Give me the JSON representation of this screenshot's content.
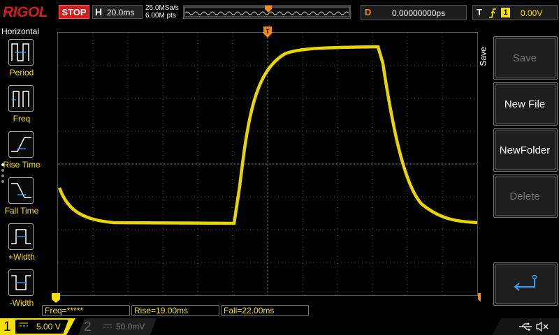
{
  "header": {
    "brand": "RIGOL",
    "run_state": "STOP",
    "timebase_letter": "H",
    "timebase": "20.0ms",
    "sample_rate": "25.0MSa/s",
    "memory_depth": "6.00M pts",
    "delay_letter": "D",
    "delay": "0.00000000ps",
    "trigger_letter": "T",
    "trigger_source": "1",
    "trigger_level": "0.00V"
  },
  "left_panel": {
    "title": "Horizontal",
    "items": [
      {
        "label": "Period",
        "icon": "period-icon"
      },
      {
        "label": "Freq",
        "icon": "freq-icon"
      },
      {
        "label": "Rise Time",
        "icon": "rise-time-icon"
      },
      {
        "label": "Fall Time",
        "icon": "fall-time-icon"
      },
      {
        "label": "+Width",
        "icon": "plus-width-icon"
      },
      {
        "label": "-Width",
        "icon": "minus-width-icon"
      }
    ]
  },
  "right_menu": {
    "tab": "Save",
    "items": [
      {
        "label": "Save",
        "enabled": false
      },
      {
        "label": "New File",
        "enabled": true
      },
      {
        "label": "NewFolder",
        "enabled": true
      },
      {
        "label": "Delete",
        "enabled": false
      }
    ],
    "enter_icon": "enter-arrow-icon"
  },
  "measurements": {
    "freq": "Freq=*****",
    "rise": "Rise=19.00ms",
    "fall": "Fall=22.00ms"
  },
  "channels": {
    "ch1_number": "1",
    "ch1_scale": "5.00 V",
    "ch2_number": "2",
    "ch2_scale": "50.0mV"
  },
  "colors": {
    "ch1": "#f5e000",
    "trigger_marker": "#f28c1e",
    "stop": "#d21d1d"
  }
}
